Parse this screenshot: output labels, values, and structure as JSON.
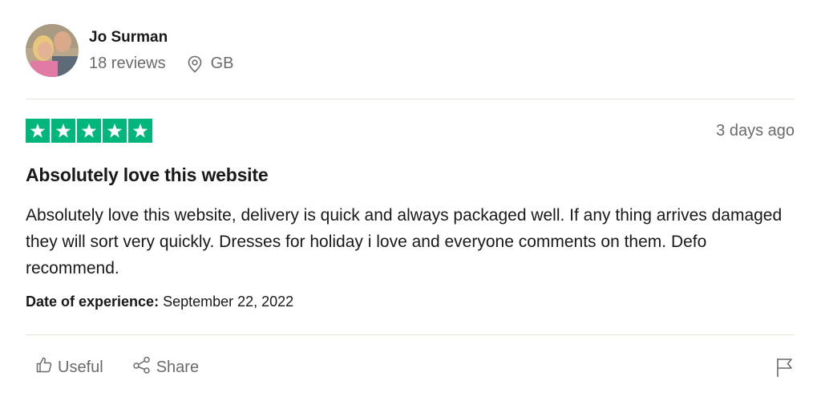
{
  "reviewer": {
    "name": "Jo Surman",
    "reviews": "18 reviews",
    "country": "GB"
  },
  "review": {
    "rating": 5,
    "max_rating": 5,
    "date_ago": "3 days ago",
    "title": "Absolutely love this website",
    "body": "Absolutely love this website, delivery is quick and always packaged well. If any thing arrives damaged they will sort very quickly. Dresses for holiday i love and everyone comments on them. Defo recommend.",
    "experience_label": "Date of experience:",
    "experience_date": "September 22, 2022"
  },
  "actions": {
    "useful_label": "Useful",
    "share_label": "Share"
  },
  "colors": {
    "star_green": "#00b67a",
    "muted_text": "#6b6b6b",
    "text": "#191919",
    "divider": "#e5e5dd"
  },
  "icons": [
    "location-pin-icon",
    "star-icon",
    "thumbs-up-icon",
    "share-icon",
    "flag-icon"
  ]
}
